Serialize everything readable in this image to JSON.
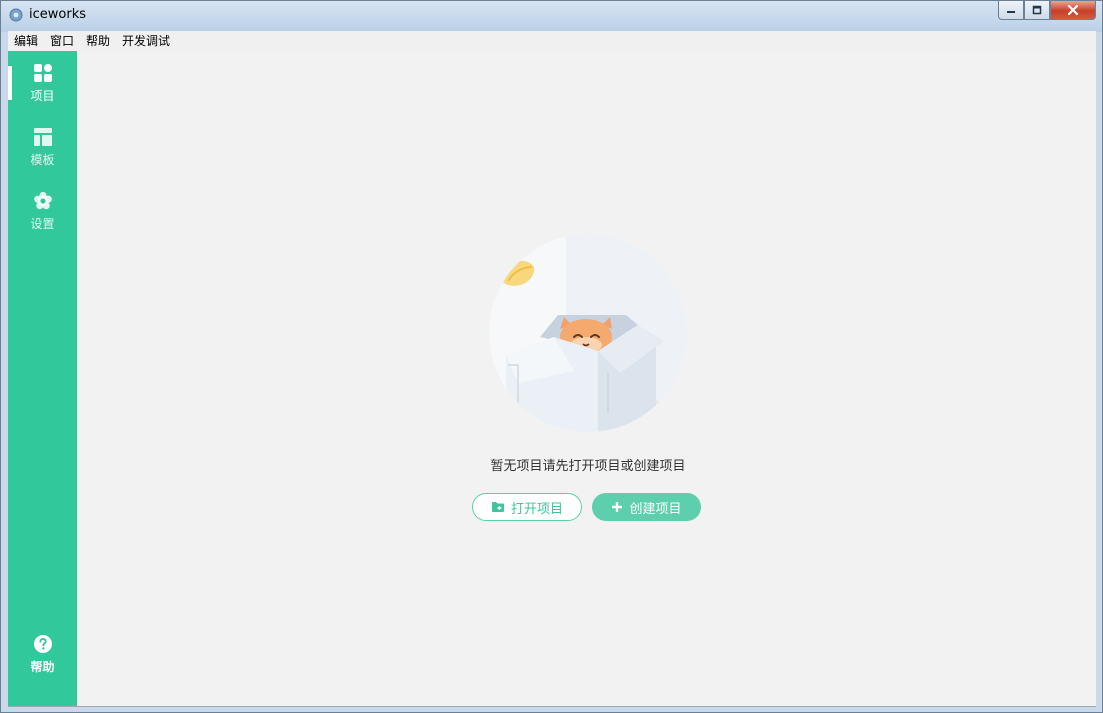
{
  "window": {
    "title": "iceworks"
  },
  "menubar": {
    "items": [
      "编辑",
      "窗口",
      "帮助",
      "开发调试"
    ]
  },
  "sidebar": {
    "items": [
      {
        "label": "项目",
        "icon": "dashboard-icon",
        "active": true
      },
      {
        "label": "模板",
        "icon": "template-icon",
        "active": false
      },
      {
        "label": "设置",
        "icon": "gear-icon",
        "active": false
      }
    ],
    "help": {
      "label": "帮助",
      "icon": "help-icon"
    }
  },
  "main": {
    "empty_message": "暂无项目请先打开项目或创建项目",
    "open_button_label": "打开项目",
    "create_button_label": "创建项目"
  },
  "colors": {
    "sidebar": "#31c89c",
    "accent": "#5ecfac",
    "background": "#f2f2f2"
  }
}
